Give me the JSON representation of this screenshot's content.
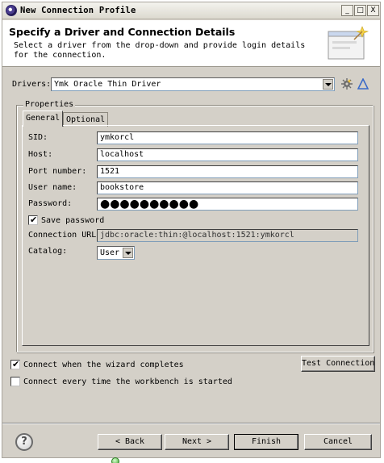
{
  "window": {
    "title": "New Connection Profile",
    "controls": {
      "minimize": "_",
      "maximize": "□",
      "close": "X"
    }
  },
  "header": {
    "title": "Specify a Driver and Connection Details",
    "description": "Select a driver from the drop-down and provide login details for the connection."
  },
  "drivers": {
    "label": "Drivers:",
    "selected": "Ymk Oracle Thin Driver"
  },
  "properties": {
    "group_label": "Properties",
    "tabs": [
      {
        "label": "General",
        "active": true
      },
      {
        "label": "Optional",
        "active": false
      }
    ],
    "fields": {
      "sid": {
        "label": "SID:",
        "value": "ymkorcl"
      },
      "host": {
        "label": "Host:",
        "value": "localhost"
      },
      "port": {
        "label": "Port number:",
        "value": "1521"
      },
      "user": {
        "label": "User name:",
        "value": "bookstore"
      },
      "password": {
        "label": "Password:",
        "value": "●●●●●●●●●●"
      }
    },
    "save_password": {
      "label": "Save password",
      "checked": true
    },
    "connection_url": {
      "label": "Connection URL:",
      "value": "jdbc:oracle:thin:@localhost:1521:ymkorcl"
    },
    "catalog": {
      "label": "Catalog:",
      "selected": "User"
    }
  },
  "options": {
    "connect_when_completes": {
      "label": "Connect when the wizard completes",
      "checked": true
    },
    "connect_every_startup": {
      "label": "Connect every time the workbench is started",
      "checked": false
    },
    "test_connection_label": "Test Connection"
  },
  "footer": {
    "help": "?",
    "back_label": "< Back",
    "next_label": "Next >",
    "finish_label": "Finish",
    "cancel_label": "Cancel"
  },
  "colors": {
    "window_bg": "#d4d0c8",
    "header_bg": "#ffffff",
    "input_border": "#7f9db9"
  }
}
